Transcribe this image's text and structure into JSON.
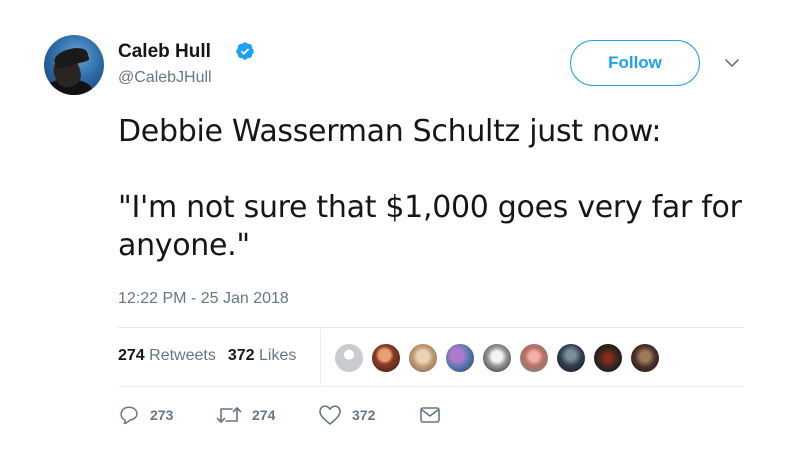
{
  "author": {
    "name": "Caleb Hull",
    "handle": "@CalebJHull",
    "verified": true
  },
  "follow_label": "Follow",
  "tweet": {
    "text": "Debbie Wasserman Schultz just now:\n\n\"I'm not sure that $1,000 goes very far for anyone.\"",
    "timestamp": "12:22 PM - 25 Jan 2018"
  },
  "stats": {
    "retweets_count": "274",
    "retweets_label": "Retweets",
    "likes_count": "372",
    "likes_label": "Likes"
  },
  "actions": {
    "reply_count": "273",
    "retweet_count": "274",
    "like_count": "372"
  },
  "colors": {
    "accent": "#1da1f2",
    "muted": "#657786",
    "text": "#14171a"
  },
  "icons": [
    "verified-badge-icon",
    "chevron-down-icon",
    "reply-icon",
    "retweet-icon",
    "heart-icon",
    "envelope-icon"
  ]
}
